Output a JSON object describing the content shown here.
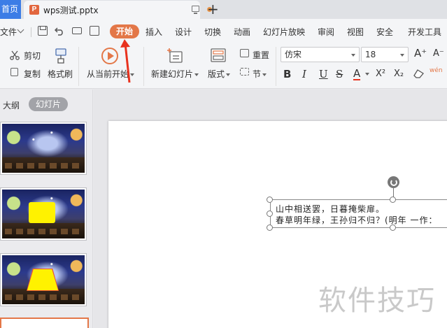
{
  "tabs": {
    "home_label": "首页",
    "doc_title": "wps测试.pptx",
    "doc_icon_letter": "P"
  },
  "menu": {
    "file_label": "文件",
    "items": [
      {
        "label": "开始",
        "active": true
      },
      {
        "label": "插入"
      },
      {
        "label": "设计"
      },
      {
        "label": "切换"
      },
      {
        "label": "动画"
      },
      {
        "label": "幻灯片放映"
      },
      {
        "label": "审阅"
      },
      {
        "label": "视图"
      },
      {
        "label": "安全"
      },
      {
        "label": "开发工具"
      }
    ]
  },
  "ribbon": {
    "cut": "剪切",
    "copy": "复制",
    "format_painter": "格式刷",
    "play_from_current": "从当前开始",
    "new_slide": "新建幻灯片",
    "layout": "版式",
    "reset": "重置",
    "section": "节",
    "font_name": "仿宋",
    "font_size": "18",
    "font_grow": "A⁺",
    "font_shrink": "A⁻",
    "bold": "B",
    "italic": "I",
    "underline": "U",
    "strike": "S",
    "font_color": "A",
    "superscript": "X²",
    "subscript": "X₂",
    "pinyin": "wén"
  },
  "panel": {
    "outline_tab": "大纲",
    "slides_tab": "幻灯片"
  },
  "slide": {
    "line1": "山中相送罢，日暮掩柴扉。",
    "line2": "春草明年绿，王孙归不归？(明年 一作："
  },
  "watermark": "软件技巧",
  "colors": {
    "accent": "#e37748",
    "home_tab": "#3c7de6",
    "arrow": "#e8321e"
  }
}
